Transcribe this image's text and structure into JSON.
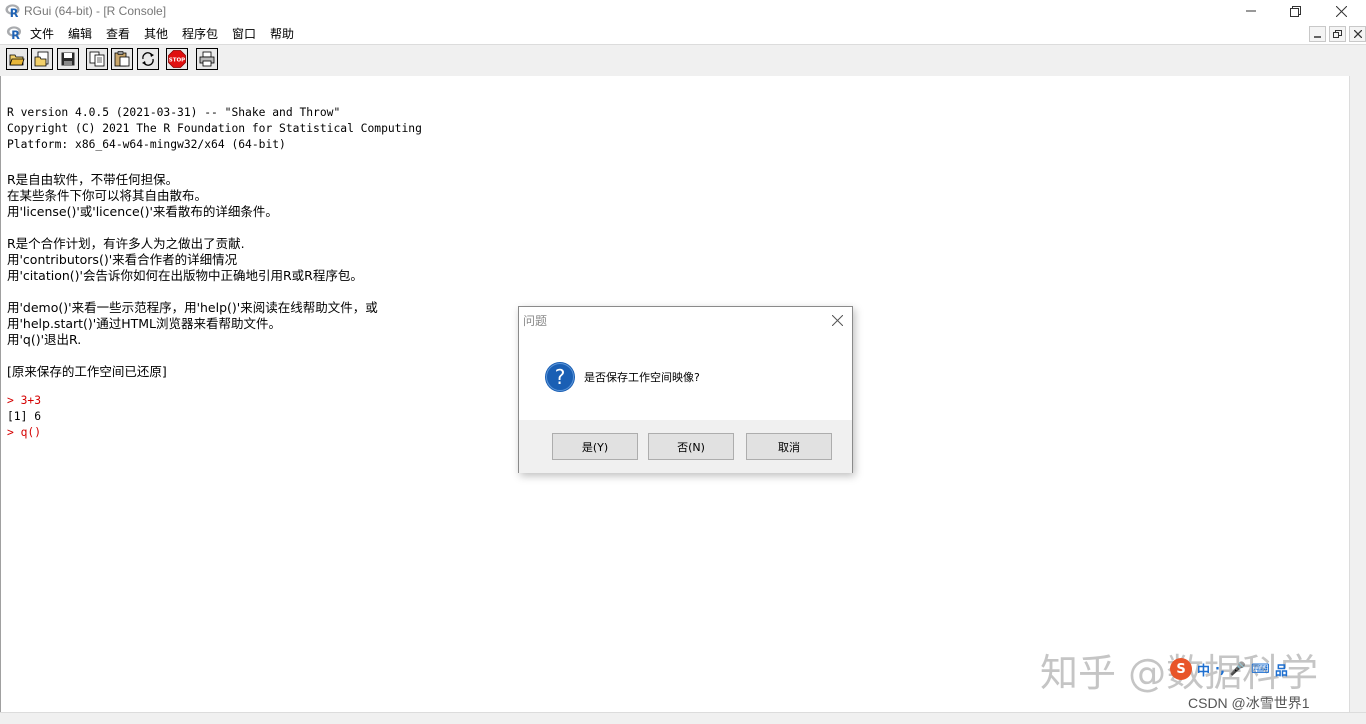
{
  "window": {
    "title": "RGui (64-bit) - [R Console]"
  },
  "menubar": {
    "items": [
      "文件",
      "编辑",
      "查看",
      "其他",
      "程序包",
      "窗口",
      "帮助"
    ]
  },
  "toolbar": {
    "buttons": [
      "open-script-icon",
      "load-workspace-icon",
      "save-icon",
      "copy-icon",
      "paste-icon",
      "copy-paste-icon",
      "stop-icon",
      "print-icon"
    ],
    "stop_label": "STOP"
  },
  "console": {
    "lines": [
      "R version 4.0.5 (2021-03-31) -- \"Shake and Throw\"",
      "Copyright (C) 2021 The R Foundation for Statistical Computing",
      "Platform: x86_64-w64-mingw32/x64 (64-bit)",
      "R是自由软件，不带任何担保。",
      "在某些条件下你可以将其自由散布。",
      "用'license()'或'licence()'来看散布的详细条件。",
      "R是个合作计划，有许多人为之做出了贡献.",
      "用'contributors()'来看合作者的详细情况",
      "用'citation()'会告诉你如何在出版物中正确地引用R或R程序包。",
      "用'demo()'来看一些示范程序，用'help()'来阅读在线帮助文件，或",
      "用'help.start()'通过HTML浏览器来看帮助文件。",
      "用'q()'退出R.",
      "[原来保存的工作空间已还原]"
    ],
    "input1": "> 3+3",
    "output1": "[1] 6",
    "input2": "> q()"
  },
  "dialog": {
    "title": "问题",
    "message": "是否保存工作空间映像?",
    "yes": "是(Y)",
    "no": "否(N)",
    "cancel": "取消"
  },
  "watermark": {
    "zhihu": "知乎 @数据科学",
    "csdn": "CSDN @冰雪世界1",
    "ime_logo": "S",
    "ime_items": [
      "中",
      "·,",
      "🎤",
      "⌨",
      "品"
    ]
  },
  "colors": {
    "prompt_red": "#d40000",
    "dialog_icon_blue": "#1a5fb4",
    "stop_red": "#e01010"
  }
}
